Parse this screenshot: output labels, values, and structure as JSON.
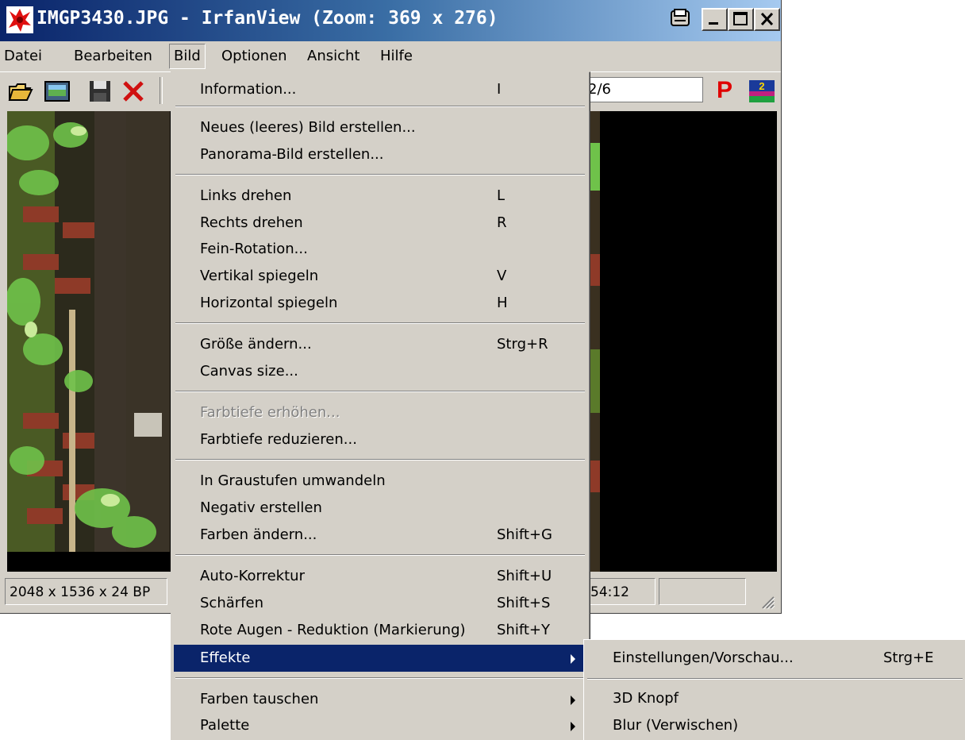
{
  "window": {
    "title": "IMGP3430.JPG - IrfanView (Zoom: 369 x 276)",
    "app_icon": "irfanview-red-cat-icon",
    "controls": [
      "print-icon",
      "minimize-icon",
      "maximize-icon",
      "close-icon"
    ]
  },
  "menubar": {
    "items": [
      "Datei",
      "Bearbeiten",
      "Bild",
      "Optionen",
      "Ansicht",
      "Hilfe"
    ],
    "open": "Bild"
  },
  "toolbar": {
    "page_indicator": "2/6",
    "icons": [
      "open-folder-icon",
      "slideshow-thumbnail-icon",
      "save-disk-icon",
      "delete-x-icon",
      "paint-p-icon",
      "multimedia-icon"
    ],
    "p_glyph": "P"
  },
  "statusbar": {
    "dimensions": "2048 x 1536 x 24 BP",
    "time": "54:12",
    "extra": ""
  },
  "dropdown": {
    "items": [
      {
        "label": "Information...",
        "shortcut": "I"
      },
      {
        "label": "Neues (leeres) Bild erstellen...",
        "shortcut": ""
      },
      {
        "label": "Panorama-Bild erstellen...",
        "shortcut": ""
      },
      {
        "label": "Links drehen",
        "shortcut": "L"
      },
      {
        "label": "Rechts drehen",
        "shortcut": "R"
      },
      {
        "label": "Fein-Rotation...",
        "shortcut": ""
      },
      {
        "label": "Vertikal spiegeln",
        "shortcut": "V"
      },
      {
        "label": "Horizontal spiegeln",
        "shortcut": "H"
      },
      {
        "label": "Größe ändern...",
        "shortcut": "Strg+R"
      },
      {
        "label": "Canvas size...",
        "shortcut": ""
      },
      {
        "label": "Farbtiefe erhöhen...",
        "shortcut": "",
        "disabled": true
      },
      {
        "label": "Farbtiefe reduzieren...",
        "shortcut": ""
      },
      {
        "label": "In Graustufen umwandeln",
        "shortcut": ""
      },
      {
        "label": "Negativ erstellen",
        "shortcut": ""
      },
      {
        "label": "Farben ändern...",
        "shortcut": "Shift+G"
      },
      {
        "label": "Auto-Korrektur",
        "shortcut": "Shift+U"
      },
      {
        "label": "Schärfen",
        "shortcut": "Shift+S"
      },
      {
        "label": "Rote Augen - Reduktion (Markierung)",
        "shortcut": "Shift+Y"
      },
      {
        "label": "Effekte",
        "shortcut": "",
        "submenu": true,
        "highlighted": true
      },
      {
        "label": "Farben tauschen",
        "shortcut": "",
        "submenu": true
      },
      {
        "label": "Palette",
        "shortcut": "",
        "submenu": true
      }
    ]
  },
  "submenu": {
    "items": [
      {
        "label": "Einstellungen/Vorschau...",
        "shortcut": "Strg+E"
      },
      {
        "label": "3D Knopf",
        "shortcut": ""
      },
      {
        "label": "Blur (Verwischen)",
        "shortcut": ""
      }
    ]
  },
  "colors": {
    "face": "#d4d0c8",
    "title_active": "#0a246a",
    "highlight": "#0a246a",
    "viewer_bg": "#000000"
  }
}
